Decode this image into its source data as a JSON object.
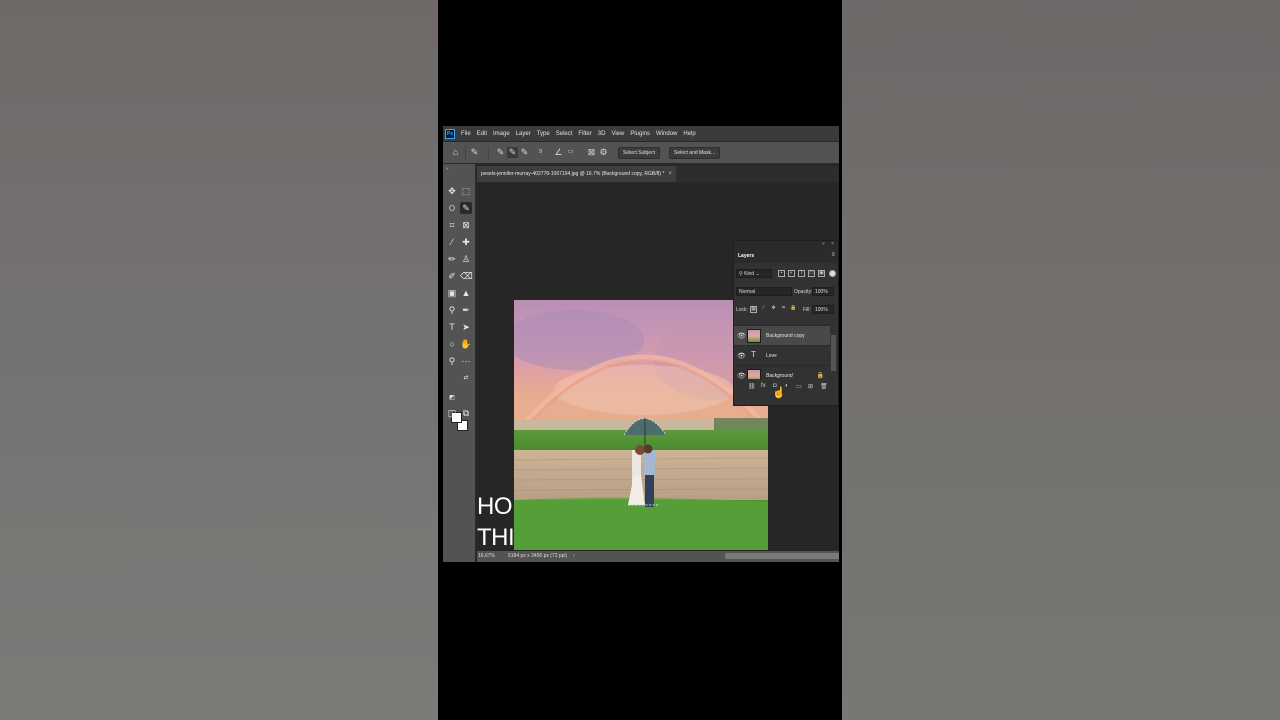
{
  "app": {
    "logo": "Ps",
    "menu": [
      "File",
      "Edit",
      "Image",
      "Layer",
      "Type",
      "Select",
      "Filter",
      "3D",
      "View",
      "Plugins",
      "Window",
      "Help"
    ]
  },
  "options_bar": {
    "size_value": "9",
    "select_subject_label": "Select Subject",
    "select_mask_label": "Select and Mask..."
  },
  "document": {
    "tab_title": "pexels-jennifer-murray-402778-1067194.jpg @ 16.7% (Background copy, RGB/8) *",
    "close": "×"
  },
  "overlay_text": {
    "line1": "HO",
    "line2": "THI"
  },
  "status": {
    "zoom": "16.67%",
    "doc_info": "5184 px x 3456 px (72 ppi)",
    "arrow": "›"
  },
  "layers_panel": {
    "title": "Layers",
    "filter_kind": "Kind",
    "blend_mode": "Normal",
    "opacity_label": "Opacity:",
    "opacity_value": "100%",
    "lock_label": "Lock:",
    "fill_label": "Fill:",
    "fill_value": "100%",
    "layers": [
      {
        "name": "Background copy",
        "type": "pixel",
        "visible": true,
        "selected": true
      },
      {
        "name": "Love",
        "type": "text",
        "visible": true,
        "selected": false
      },
      {
        "name": "Background",
        "type": "pixel",
        "visible": true,
        "selected": false,
        "locked": true
      }
    ],
    "footer_icons": [
      "link-icon",
      "fx-icon",
      "mask-icon",
      "adjustment-icon",
      "group-icon",
      "new-layer-icon",
      "trash-icon"
    ]
  },
  "colors": {
    "ps_blue": "#31a8ff",
    "panel_bg": "#323232",
    "workspace_bg": "#282828"
  }
}
